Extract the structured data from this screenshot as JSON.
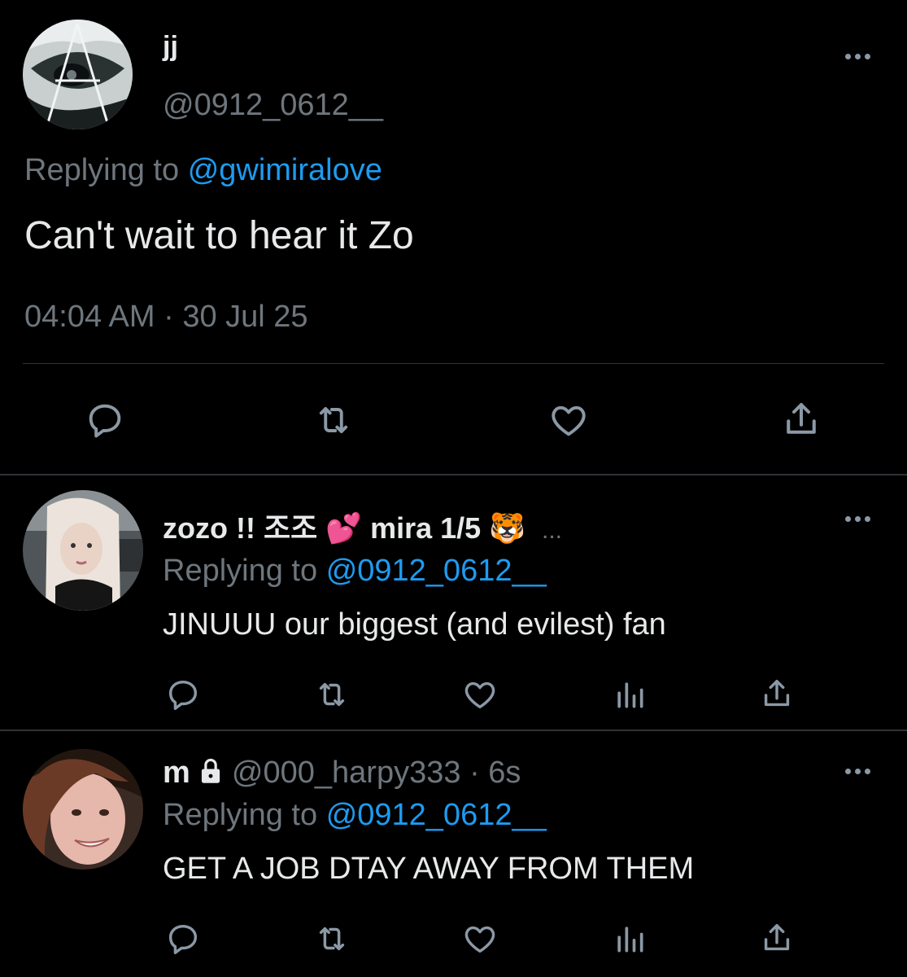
{
  "main_tweet": {
    "display_name": "jj",
    "handle": "@0912_0612__",
    "replying_prefix": "Replying to",
    "replying_handle": "@gwimiralove",
    "text": "Can't wait to hear it Zo",
    "time": "04:04 AM",
    "separator": "·",
    "date": "30 Jul 25",
    "icons": [
      "reply-icon",
      "retweet-icon",
      "like-icon",
      "share-icon"
    ]
  },
  "replies": [
    {
      "display_name": "zozo !! 조조",
      "emoji_1": "💕",
      "display_name_2": "mira 1/5",
      "emoji_2": "🐯",
      "ellipsis": "...",
      "replying_prefix": "Replying to",
      "replying_handle": "@0912_0612__",
      "text": "JINUUU our biggest (and evilest) fan",
      "icons": [
        "reply-icon",
        "retweet-icon",
        "like-icon",
        "analytics-icon",
        "share-icon"
      ]
    },
    {
      "display_name": "m",
      "lock_icon": "lock-icon",
      "handle": "@000_harpy333",
      "separator": "·",
      "time_ago": "6s",
      "replying_prefix": "Replying to",
      "replying_handle": "@0912_0612__",
      "text": "GET A JOB DTAY AWAY FROM THEM",
      "icons": [
        "reply-icon",
        "retweet-icon",
        "like-icon",
        "analytics-icon",
        "share-icon"
      ]
    }
  ],
  "colors": {
    "background": "#000000",
    "text": "#e7e9ea",
    "muted": "#6e767d",
    "link": "#1d9bf0",
    "divider": "#2f3336"
  }
}
